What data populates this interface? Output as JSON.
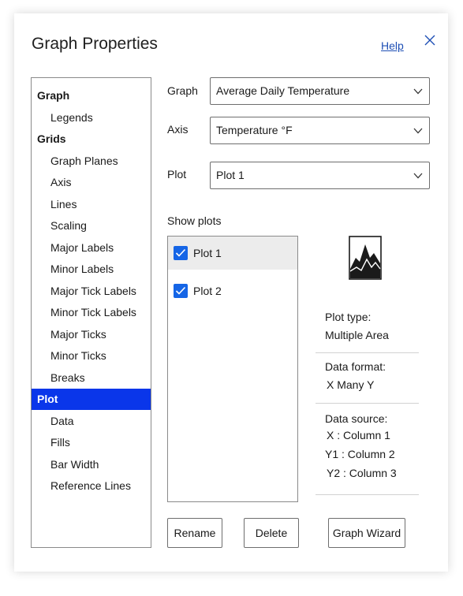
{
  "dialog": {
    "title": "Graph Properties",
    "help_label": "Help",
    "close_icon": "close-icon",
    "accent_color": "#0a36ea"
  },
  "nav": {
    "items": [
      {
        "label": "Graph",
        "level": "top"
      },
      {
        "label": "Legends",
        "level": "sub"
      },
      {
        "label": "Grids",
        "level": "top"
      },
      {
        "label": "Graph Planes",
        "level": "sub"
      },
      {
        "label": "Axis",
        "level": "sub"
      },
      {
        "label": "Lines",
        "level": "sub"
      },
      {
        "label": "Scaling",
        "level": "sub"
      },
      {
        "label": "Major Labels",
        "level": "sub"
      },
      {
        "label": "Minor Labels",
        "level": "sub"
      },
      {
        "label": "Major Tick Labels",
        "level": "sub"
      },
      {
        "label": "Minor Tick Labels",
        "level": "sub"
      },
      {
        "label": "Major Ticks",
        "level": "sub"
      },
      {
        "label": "Minor Ticks",
        "level": "sub"
      },
      {
        "label": "Breaks",
        "level": "sub"
      },
      {
        "label": "Plot",
        "level": "top",
        "selected": true
      },
      {
        "label": "Data",
        "level": "sub"
      },
      {
        "label": "Fills",
        "level": "sub"
      },
      {
        "label": "Bar Width",
        "level": "sub"
      },
      {
        "label": "Reference Lines",
        "level": "sub"
      }
    ]
  },
  "fields": {
    "graph": {
      "label": "Graph",
      "value": "Average Daily Temperature"
    },
    "axis": {
      "label": "Axis",
      "value": "Temperature °F"
    },
    "plot": {
      "label": "Plot",
      "value": "Plot 1"
    }
  },
  "show_plots": {
    "label": "Show plots",
    "plots": [
      {
        "label": "Plot 1",
        "checked": true,
        "highlighted": true
      },
      {
        "label": "Plot 2",
        "checked": true
      }
    ]
  },
  "info": {
    "thumbnail_icon": "area-chart-icon",
    "plot_type_label": "Plot type:",
    "plot_type_value": "Multiple Area",
    "data_format_label": "Data format:",
    "data_format_value": "X Many Y",
    "data_source_label": "Data source:",
    "data_source_values": [
      "X : Column 1",
      "Y1 : Column 2",
      "Y2 : Column 3"
    ]
  },
  "buttons": {
    "rename": "Rename",
    "delete": "Delete",
    "graph_wizard": "Graph Wizard"
  }
}
